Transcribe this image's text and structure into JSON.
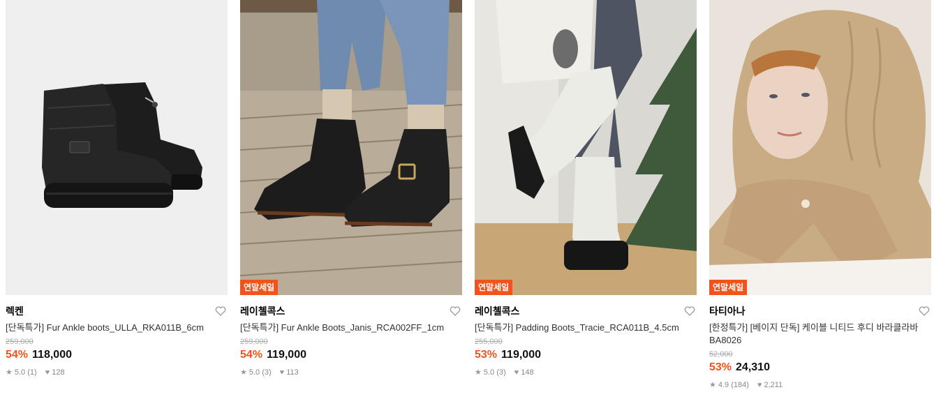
{
  "products": [
    {
      "badge": "",
      "brand": "렉켄",
      "name": "[단독특가] Fur Ankle boots_ULLA_RKA011B_6cm",
      "original_price": "259,000",
      "discount": "54%",
      "price": "118,000",
      "rating": "5.0 (1)",
      "likes": "128"
    },
    {
      "badge": "연말세일",
      "brand": "레이첼콕스",
      "name": "[단독특가] Fur Ankle Boots_Janis_RCA002FF_1cm",
      "original_price": "259,000",
      "discount": "54%",
      "price": "119,000",
      "rating": "5.0 (3)",
      "likes": "113"
    },
    {
      "badge": "연말세일",
      "brand": "레이첼콕스",
      "name": "[단독특가] Padding Boots_Tracie_RCA011B_4.5cm",
      "original_price": "255,000",
      "discount": "53%",
      "price": "119,000",
      "rating": "5.0 (3)",
      "likes": "148"
    },
    {
      "badge": "연말세일",
      "brand": "타티아나",
      "name": "[한정특가] [베이지 단독] 케이블 니티드 후디 바라클라바 BA8026",
      "original_price": "52,000",
      "discount": "53%",
      "price": "24,310",
      "rating": "4.9 (184)",
      "likes": "2,211"
    }
  ],
  "colors": {
    "accent": "#f0531c",
    "muted": "#888888"
  },
  "icons": {
    "rating": "star-icon",
    "like": "heart-icon",
    "wishlist": "heart-outline-icon"
  }
}
